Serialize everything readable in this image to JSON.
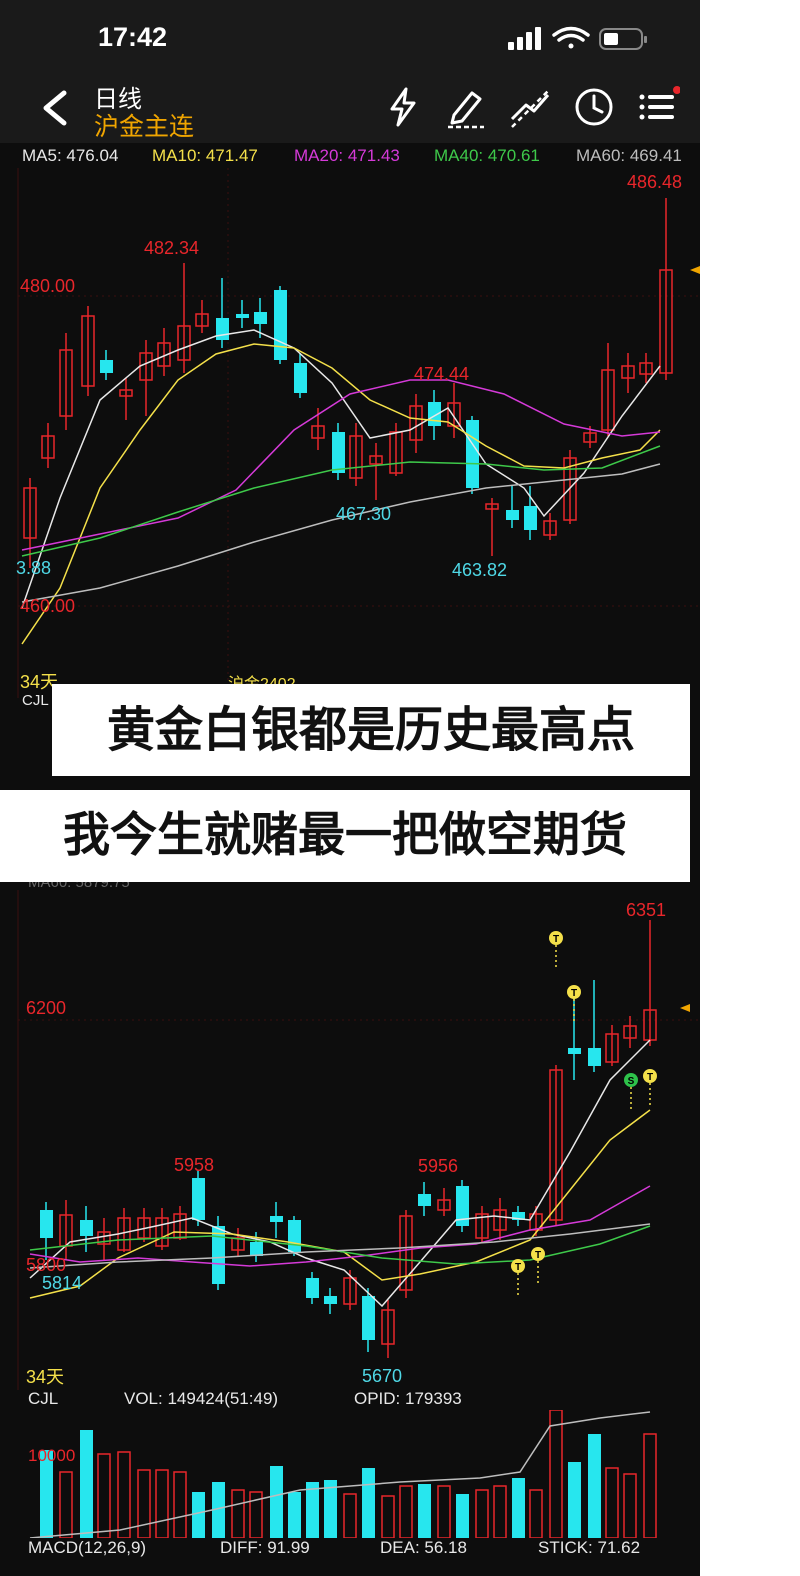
{
  "status": {
    "time": "17:42"
  },
  "header": {
    "title": "日线",
    "subtitle": "沪金主连"
  },
  "ma": {
    "ma5": "MA5: 476.04",
    "ma10": "MA10: 471.47",
    "ma20": "MA20: 471.43",
    "ma40": "MA40: 470.61",
    "ma60": "MA60: 469.41"
  },
  "chart1": {
    "high_label": "486.48",
    "peak1_label": "482.34",
    "level_480": "480.00",
    "level_460": "460.00",
    "peak2_label": "474.44",
    "low1_label": "467.30",
    "low2_label": "463.82",
    "left_label": "3.88",
    "days": "34天",
    "cjl": "CJL",
    "cut_text": "沪金2402"
  },
  "chart2": {
    "ma60_partial": "MA60: 5879.75",
    "high_label": "6351",
    "level_6200": "6200",
    "peak1_label": "5958",
    "peak2_label": "5956",
    "level_5800": "5800",
    "low1_label": "5814",
    "low2_label": "5670",
    "days": "34天",
    "marker_t": "T",
    "marker_s": "S"
  },
  "volume": {
    "cjl": "CJL",
    "vol": "VOL: 149424(51:49)",
    "opid": "OPID: 179393",
    "level": "10000"
  },
  "macd": {
    "label": "MACD(12,26,9)",
    "diff": "DIFF: 91.99",
    "dea": "DEA: 56.18",
    "stick": "STICK: 71.62"
  },
  "captions": {
    "line1": "黄金白银都是历史最高点",
    "line2": "我今生就赌最一把做空期货"
  },
  "colors": {
    "up": "#e8262b",
    "down": "#27e6ee",
    "ma5": "#e8e8e8",
    "ma10": "#f4e04a",
    "ma20": "#d53ad8",
    "ma40": "#3ec94a",
    "ma60": "#bdbdbd"
  }
}
